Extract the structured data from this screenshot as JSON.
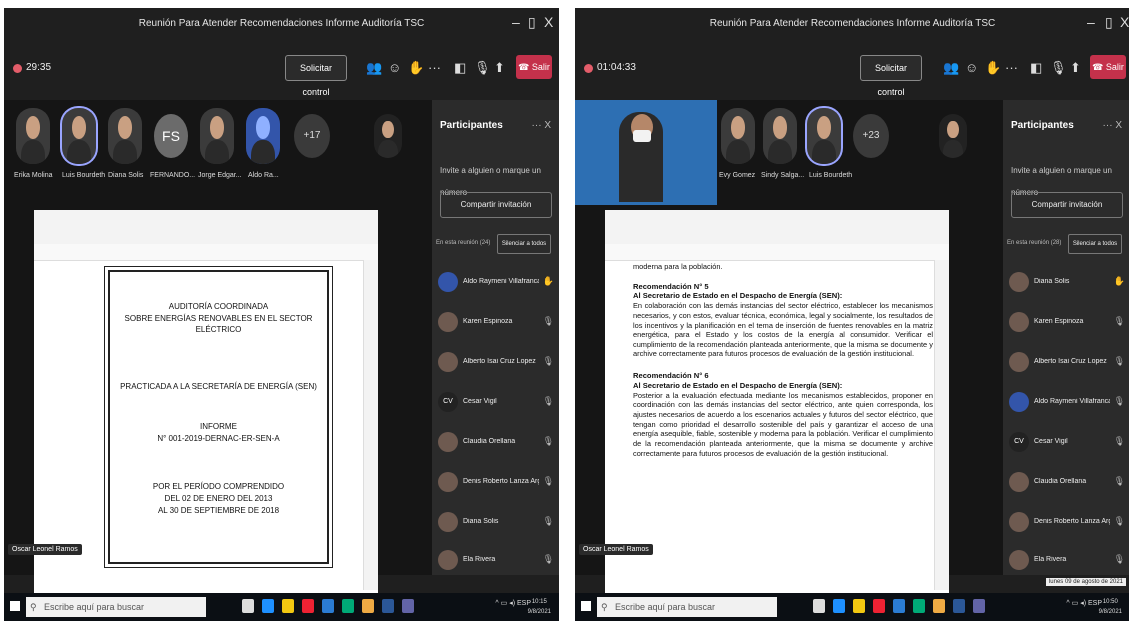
{
  "left": {
    "title": "Reunión Para Atender Recomendaciones Informe Auditoría TSC",
    "timer": "29:35",
    "request_control": "Solicitar control",
    "leave": "Salir",
    "tiles": [
      {
        "name": "Erika Molina"
      },
      {
        "name": "Luis Bourdeth"
      },
      {
        "name": "Diana Solis"
      },
      {
        "name": "FERNANDO...",
        "initials": "FS"
      },
      {
        "name": "Jorge Edgar..."
      },
      {
        "name": "Aldo Ra..."
      }
    ],
    "more_count": "+17",
    "cover": {
      "line1": "AUDITORÍA COORDINADA",
      "line2": "SOBRE ENERGÍAS RENOVABLES EN EL SECTOR ELÉCTRICO",
      "line3": "PRACTICADA A LA SECRETARÍA DE ENERGÍA (SEN)",
      "line4": "INFORME",
      "line5": "N° 001-2019-DERNAC-ER-SEN-A",
      "line6": "POR EL PERÍODO COMPRENDIDO",
      "line7": "DEL 02 DE ENERO DEL 2013",
      "line8": "AL 30 DE SEPTIEMBRE DE 2018"
    },
    "presenter": "Oscar Leonel Ramos",
    "panel": {
      "title": "Participantes",
      "invite": "Invite a alguien o marque un número",
      "share": "Compartir invitación",
      "in_meeting": "En esta reunión (24)",
      "mute_all": "Silenciar a todos",
      "people": [
        "Aldo Raymeni Villafranca ...",
        "Karen Espinoza",
        "Alberto Isai Cruz Lopez",
        "Cesar Vigil",
        "Claudia Orellana",
        "Denis Roberto Lanza Argueta",
        "Diana Solis",
        "Ela Rivera"
      ]
    },
    "taskbar": {
      "search": "Escribe aquí para buscar",
      "time": "10:15",
      "date": "9/8/2021",
      "lang": "ESP"
    }
  },
  "right": {
    "title": "Reunión Para Atender Recomendaciones Informe Auditoría TSC",
    "timer": "01:04:33",
    "request_control": "Solicitar control",
    "leave": "Salir",
    "tiles": [
      {
        "name": "Evy Gomez"
      },
      {
        "name": "Sindy Salga..."
      },
      {
        "name": "Luis Bourdeth"
      }
    ],
    "more_count": "+23",
    "doc": {
      "top": "moderna para la población.",
      "rec5_title": "Recomendación N° 5",
      "rec5_to": "Al Secretario de Estado en el Despacho de Energía (SEN):",
      "rec5_body": "En colaboración con las demás instancias del sector eléctrico, establecer los mecanismos necesarios, y con estos, evaluar técnica, económica, legal y socialmente, los resultados de los incentivos y la planificación en el tema de inserción de fuentes renovables en la matriz energética, para el Estado y los costos de la energía al consumidor. Verificar el cumplimiento de la recomendación planteada anteriormente, que la misma se documente y archive correctamente para futuros procesos de evaluación de la gestión institucional.",
      "rec6_title": "Recomendación N° 6",
      "rec6_to": "Al Secretario de Estado en el Despacho de Energía (SEN):",
      "rec6_body": "Posterior a la evaluación efectuada mediante los mecanismos establecidos, proponer en coordinación con las demás instancias del sector eléctrico, ante quien corresponda, los ajustes necesarios de acuerdo a los escenarios actuales y futuros del sector eléctrico, que tengan como prioridad el desarrollo sostenible del país y garantizar el acceso de una energía asequible, fiable, sostenible y moderna para la población. Verificar el cumplimiento de la recomendación planteada anteriormente, que la misma se documente y archive correctamente para futuros procesos de evaluación de la gestión institucional."
    },
    "presenter": "Oscar Leonel Ramos",
    "panel": {
      "title": "Participantes",
      "invite": "Invite a alguien o marque un número",
      "share": "Compartir invitación",
      "in_meeting": "En esta reunión (28)",
      "mute_all": "Silenciar a todos",
      "people": [
        "Diana Solis",
        "Karen Espinoza",
        "Alberto Isai Cruz Lopez",
        "Aldo Raymeni Villafranca Castro",
        "Cesar Vigil",
        "Claudia Orellana",
        "Denis Roberto Lanza Argueta",
        "Ela Rivera"
      ]
    },
    "tooltip": "lunes 09 de agosto de 2021",
    "taskbar": {
      "search": "Escribe aquí para buscar",
      "time": "10:50",
      "date": "9/8/2021",
      "lang": "ESP"
    }
  },
  "colors": {
    "leave": "#c4314b",
    "accent": "#9aa5ff",
    "bg": "#1f1f1f"
  }
}
